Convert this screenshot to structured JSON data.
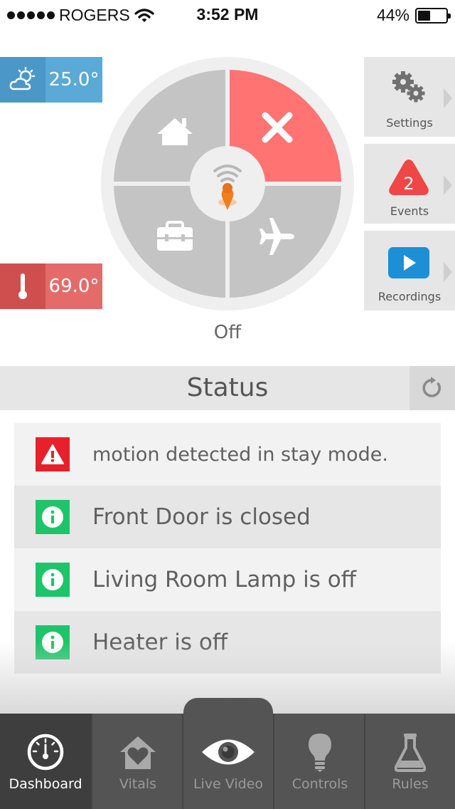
{
  "status_bar": {
    "carrier": "ROGERS",
    "time": "3:52 PM",
    "battery_text": "44%",
    "battery_level": 0.44,
    "signal_bars": 5,
    "icons": [
      "signal-dots-icon",
      "wifi-icon",
      "battery-icon"
    ]
  },
  "weather": {
    "value": "25.0°",
    "icon": "partly-cloudy-icon",
    "color": "#5aa9d6"
  },
  "indoor_temp": {
    "value": "69.0°",
    "icon": "thermometer-icon",
    "color": "#e56b6b"
  },
  "mode_wheel": {
    "current_mode_label": "Off",
    "segments": [
      {
        "mode": "home",
        "icon": "home-icon",
        "active": false
      },
      {
        "mode": "off",
        "icon": "close-icon",
        "active": true,
        "color": "#ff7373"
      },
      {
        "mode": "stay",
        "icon": "briefcase-icon",
        "active": false
      },
      {
        "mode": "away",
        "icon": "airplane-icon",
        "active": false
      }
    ],
    "center_icon": "wifi-location-pin-icon"
  },
  "side_menu": {
    "settings": {
      "label": "Settings",
      "icon": "gears-icon"
    },
    "events": {
      "label": "Events",
      "count": "2",
      "icon": "warning-triangle-icon",
      "color": "#ef4646"
    },
    "recordings": {
      "label": "Recordings",
      "icon": "play-icon",
      "color": "#1c8fd6"
    }
  },
  "status_section": {
    "title": "Status",
    "refresh_icon": "refresh-icon",
    "items": [
      {
        "type": "alert",
        "icon": "alert-icon",
        "text": "motion detected in stay mode."
      },
      {
        "type": "info",
        "icon": "info-icon",
        "text": "Front Door is closed"
      },
      {
        "type": "info",
        "icon": "info-icon",
        "text": "Living Room Lamp is off"
      },
      {
        "type": "info",
        "icon": "info-icon",
        "text": "Heater is off"
      }
    ]
  },
  "tabs": [
    {
      "label": "Dashboard",
      "icon": "gauge-icon",
      "active": true
    },
    {
      "label": "Vitals",
      "icon": "house-heart-icon",
      "active": false
    },
    {
      "label": "Live Video",
      "icon": "eye-icon",
      "active": false
    },
    {
      "label": "Controls",
      "icon": "lightbulb-icon",
      "active": false
    },
    {
      "label": "Rules",
      "icon": "flask-icon",
      "active": false
    }
  ],
  "colors": {
    "alert_red": "#e8202a",
    "info_green": "#1ec46a",
    "tab_bar": "#545454",
    "tab_active": "#3e3e3e"
  }
}
